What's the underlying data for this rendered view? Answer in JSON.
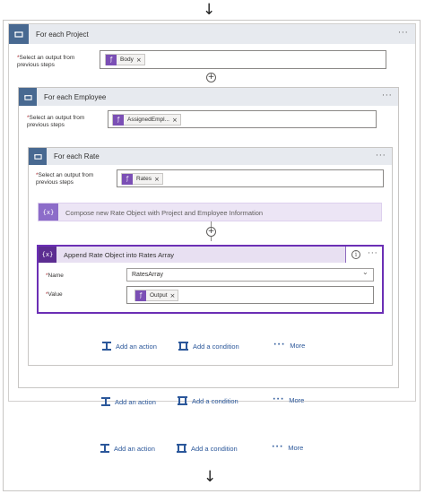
{
  "flow": {
    "for_each_project": {
      "title": "For each Project",
      "field_label": "Select an output from previous steps",
      "token": "Body"
    },
    "for_each_employee": {
      "title": "For each Employee",
      "field_label": "Select an output from previous steps",
      "token": "AssignedEmpl..."
    },
    "for_each_rate": {
      "title": "For each Rate",
      "field_label": "Select an output from previous steps",
      "token": "Rates"
    },
    "compose": {
      "title": "Compose new Rate Object with Project and Employee Information",
      "icon": "{x}"
    },
    "append": {
      "title": "Append Rate Object into Rates Array",
      "icon": "{x}",
      "name_label": "Name",
      "name_value": "RatesArray",
      "value_label": "Value",
      "value_token": "Output"
    }
  },
  "actions": {
    "add_action": "Add an action",
    "add_condition": "Add a condition",
    "more": "More"
  },
  "glyphs": {
    "down_arrow": "↓",
    "ellipsis": "···",
    "remove": "×",
    "plus": "+",
    "info": "i",
    "chevron": "⌄"
  },
  "colors": {
    "loop_icon": "#486991",
    "header_bg": "#e7eaef",
    "variable_icon": "#5c2d91",
    "selected_border": "#6b2fb5",
    "link": "#2b579a"
  }
}
